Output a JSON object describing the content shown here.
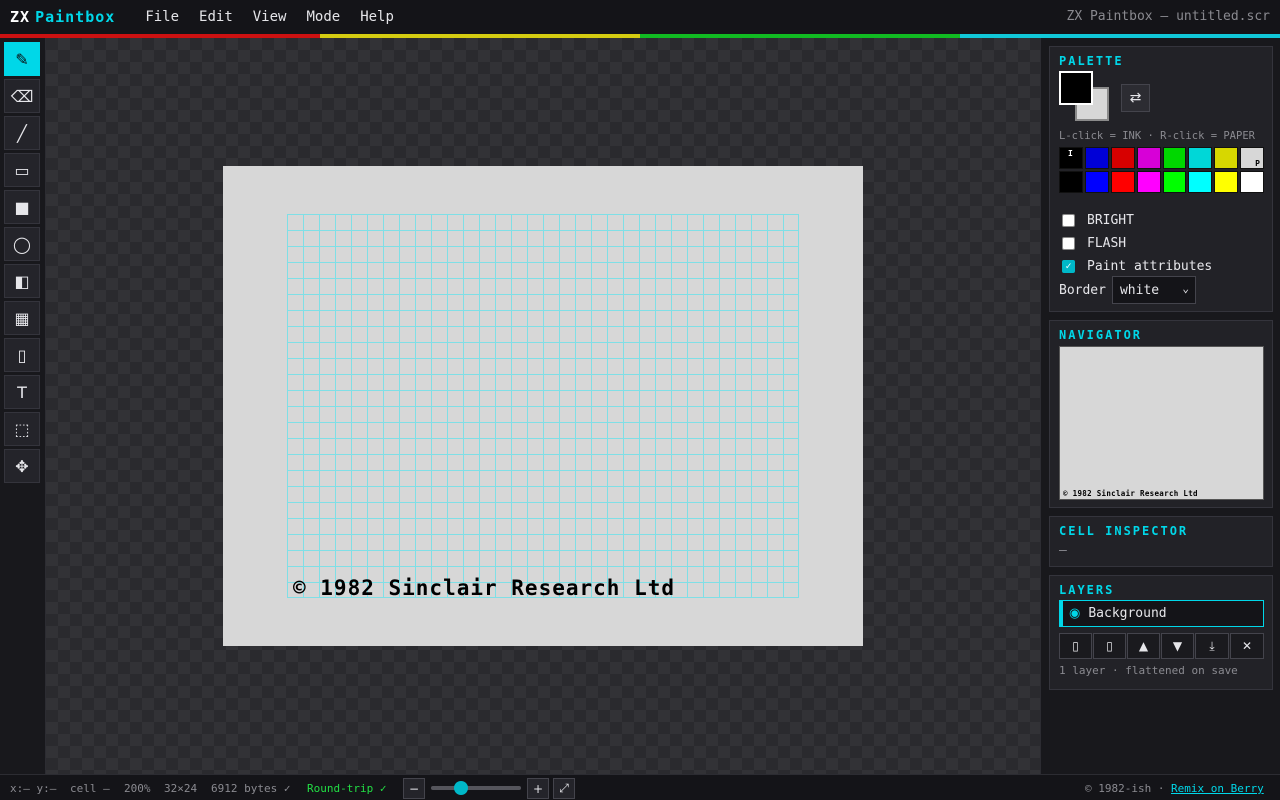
{
  "app": {
    "logo_zx": "ZX",
    "logo_paintbox": "Paintbox",
    "document_title": "ZX Paintbox — untitled.scr"
  },
  "menu": [
    "File",
    "Edit",
    "View",
    "Mode",
    "Help"
  ],
  "stripe_colors": [
    "#cc1111",
    "#d4cc11",
    "#11bb22",
    "#11c8d8"
  ],
  "tools": [
    {
      "name": "pencil",
      "glyph": "✎",
      "active": true
    },
    {
      "name": "eraser",
      "glyph": "⌫",
      "active": false
    },
    {
      "name": "line",
      "glyph": "╱",
      "active": false
    },
    {
      "name": "rectangle",
      "glyph": "▭",
      "active": false
    },
    {
      "name": "filled-rectangle",
      "glyph": "■",
      "active": false
    },
    {
      "name": "ellipse",
      "glyph": "◯",
      "active": false
    },
    {
      "name": "fill",
      "glyph": "◧",
      "active": false
    },
    {
      "name": "pattern",
      "glyph": "▦",
      "active": false
    },
    {
      "name": "eyedropper",
      "glyph": "▯",
      "active": false
    },
    {
      "name": "text",
      "glyph": "T",
      "active": false
    },
    {
      "name": "select",
      "glyph": "⬚",
      "active": false
    },
    {
      "name": "move",
      "glyph": "✥",
      "active": false
    }
  ],
  "canvas": {
    "border_color": "#d7d7d7",
    "paper_color": "#d7d7d7",
    "grid_color": "#7fdfe6",
    "text": "© 1982 Sinclair Research Ltd"
  },
  "palette": {
    "title": "PALETTE",
    "ink_color": "#000000",
    "paper_color": "#d7d7d7",
    "swap_glyph": "⇄",
    "hint": "L-click = INK · R-click = PAPER",
    "ink_marker": "I",
    "paper_marker": "P",
    "normal_colors": [
      "#000000",
      "#0000d7",
      "#d70000",
      "#d700d7",
      "#00d700",
      "#00d7d7",
      "#d7d700",
      "#d7d7d7"
    ],
    "bright_colors": [
      "#000000",
      "#0000ff",
      "#ff0000",
      "#ff00ff",
      "#00ff00",
      "#00ffff",
      "#ffff00",
      "#ffffff"
    ],
    "bright_label": "BRIGHT",
    "bright_checked": false,
    "flash_label": "FLASH",
    "flash_checked": false,
    "paint_attr_label": "Paint attributes",
    "paint_attr_checked": true,
    "border_label": "Border",
    "border_value": "white"
  },
  "navigator": {
    "title": "NAVIGATOR",
    "preview_text": "© 1982 Sinclair Research Ltd"
  },
  "inspector": {
    "title": "CELL INSPECTOR",
    "value": "–"
  },
  "layers": {
    "title": "LAYERS",
    "items": [
      {
        "name": "Background",
        "selected": true
      }
    ],
    "buttons": [
      {
        "name": "add-layer",
        "glyph": "▯"
      },
      {
        "name": "duplicate-layer",
        "glyph": "▯"
      },
      {
        "name": "move-up",
        "glyph": "▲"
      },
      {
        "name": "move-down",
        "glyph": "▼"
      },
      {
        "name": "merge-down",
        "glyph": "⤓"
      },
      {
        "name": "delete-layer",
        "glyph": "✕"
      }
    ],
    "note": "1 layer · flattened on save"
  },
  "status": {
    "coords": "x:– y:–",
    "cell": "cell –",
    "zoom": "200%",
    "grid_size": "32×24",
    "bytes": "6912 bytes ✓",
    "roundtrip": "Round-trip ✓",
    "zoom_out": "−",
    "zoom_in": "+",
    "fit": "⤢",
    "zoom_level_fraction": 0.3,
    "copyright": "© 1982-ish ·",
    "remix": "Remix on Berry"
  }
}
